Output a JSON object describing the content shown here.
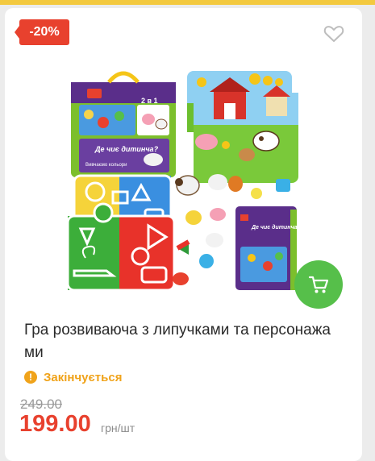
{
  "discount_badge": "-20%",
  "product": {
    "title": "Гра розвиваюча з липучками та персонажа ми",
    "status": "Закінчується",
    "status_icon": "exclamation-icon",
    "old_price": "249.00",
    "new_price": "199.00",
    "unit": "грн/шт",
    "box_text": {
      "top_label": "2 в 1",
      "main_title": "Де чиє дитинча?",
      "sub_title": "Вивчаємо кольори"
    }
  },
  "icons": {
    "wishlist": "heart-outline-icon",
    "cart": "cart-icon"
  },
  "colors": {
    "accent_red": "#e8412e",
    "cart_green": "#56bf4a",
    "status_orange": "#f0a31a",
    "top_strip": "#f3c93f"
  }
}
